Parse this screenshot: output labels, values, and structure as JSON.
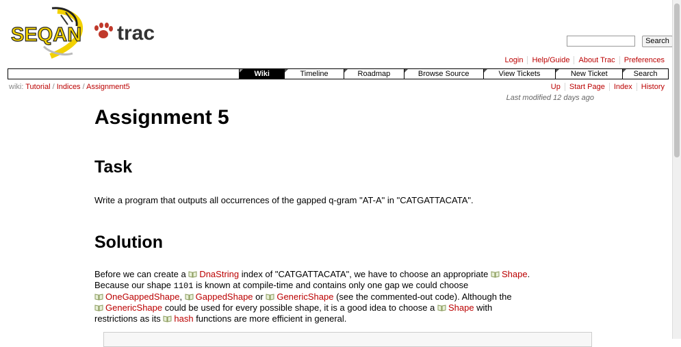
{
  "logo": {
    "left_text": "SEQAN",
    "right_text": "trac"
  },
  "search": {
    "placeholder": "",
    "button_label": "Search"
  },
  "metanav": [
    "Login",
    "Help/Guide",
    "About Trac",
    "Preferences"
  ],
  "mainnav": [
    {
      "label": "Wiki",
      "active": true
    },
    {
      "label": "Timeline",
      "active": false
    },
    {
      "label": "Roadmap",
      "active": false
    },
    {
      "label": "Browse Source",
      "active": false
    },
    {
      "label": "View Tickets",
      "active": false
    },
    {
      "label": "New Ticket",
      "active": false
    },
    {
      "label": "Search",
      "active": false
    }
  ],
  "breadcrumb": {
    "prefix": "wiki:",
    "items": [
      "Tutorial",
      "Indices",
      "Assignment5"
    ]
  },
  "ctxtnav": [
    "Up",
    "Start Page",
    "Index",
    "History"
  ],
  "last_modified": "Last modified 12 days ago",
  "page": {
    "title": "Assignment 5",
    "task_heading": "Task",
    "task_text": "Write a program that outputs all occurrences of the gapped q-gram \"AT-A\" in \"CATGATTACATA\".",
    "solution_heading": "Solution",
    "solution": {
      "t1": "Before we can create a ",
      "l1": "DnaString",
      "t2": " index of \"CATGATTACATA\", we have to choose an appropriate ",
      "l2": "Shape",
      "t3": ".",
      "t4": "Because our shape ",
      "code1": "1101",
      "t5": " is known at compile-time and contains only one gap we could choose",
      "l3": "OneGappedShape",
      "t6": ", ",
      "l4": "GappedShape",
      "t7": " or ",
      "l5": "GenericShape",
      "t8": " (see the commented-out code). Although the",
      "l6": "GenericShape",
      "t9": " could be used for every possible shape, it is a good idea to choose a ",
      "l7": "Shape",
      "t10": " with",
      "t11": "restrictions as its ",
      "l8": "hash",
      "t12": " functions are more efficient in general."
    }
  },
  "colors": {
    "link": "#bb0000",
    "logo_yellow": "#f2d100",
    "logo_red": "#c0392b"
  }
}
